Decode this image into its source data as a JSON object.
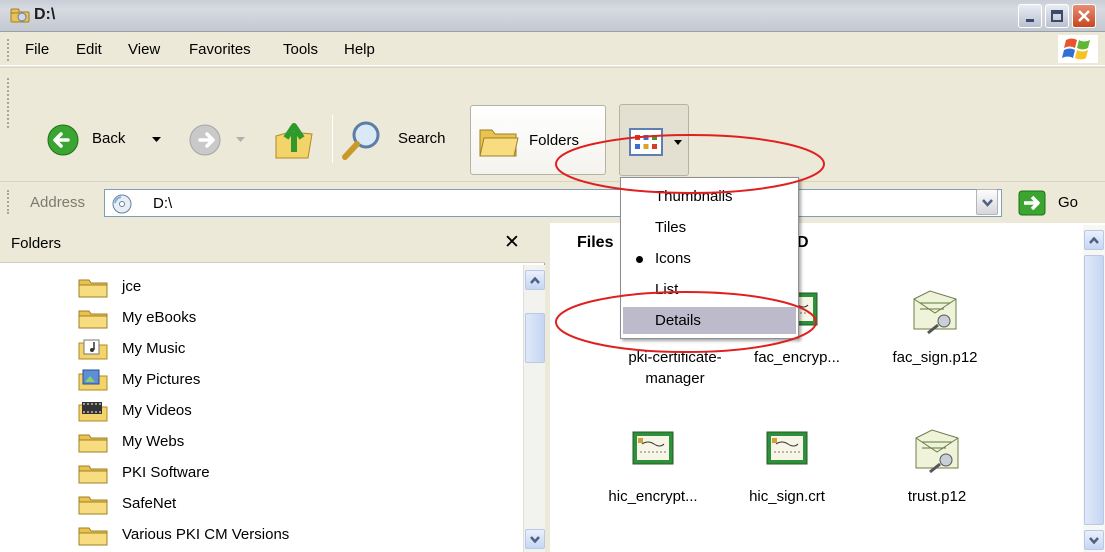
{
  "window": {
    "title": "D:\\"
  },
  "menu": [
    "File",
    "Edit",
    "View",
    "Favorites",
    "Tools",
    "Help"
  ],
  "toolbar": {
    "back_label": "Back",
    "search_label": "Search",
    "folders_label": "Folders"
  },
  "address": {
    "label": "Address",
    "value": "D:\\",
    "go_label": "Go"
  },
  "folders_pane": {
    "title": "Folders",
    "close_glyph": "✕",
    "items": [
      {
        "label": "jce",
        "expandable": false
      },
      {
        "label": "My eBooks",
        "expandable": false
      },
      {
        "label": "My Music",
        "expandable": false
      },
      {
        "label": "My Pictures",
        "expandable": false
      },
      {
        "label": "My Videos",
        "expandable": false
      },
      {
        "label": "My Webs",
        "expandable": true
      },
      {
        "label": "PKI Software",
        "expandable": true
      },
      {
        "label": "SafeNet",
        "expandable": true
      },
      {
        "label": "Various PKI CM Versions",
        "expandable": false
      }
    ]
  },
  "files_pane": {
    "heading_left": "Files",
    "heading_right": "CD",
    "files": [
      {
        "name": "pki-certificate-manager",
        "name_lines": [
          "pki-certificate-",
          "manager"
        ],
        "icon": "certificate-icon"
      },
      {
        "name": "fac_encryp...",
        "name_lines": [
          "fac_encryp..."
        ],
        "icon": "certificate-icon"
      },
      {
        "name": "fac_sign.p12",
        "name_lines": [
          "fac_sign.p12"
        ],
        "icon": "pfx-key-icon"
      },
      {
        "name": "hic_encrypt...",
        "name_lines": [
          "hic_encrypt..."
        ],
        "icon": "certificate-icon"
      },
      {
        "name": "hic_sign.crt",
        "name_lines": [
          "hic_sign.crt"
        ],
        "icon": "certificate-icon"
      },
      {
        "name": "trust.p12",
        "name_lines": [
          "trust.p12"
        ],
        "icon": "pfx-key-icon"
      }
    ]
  },
  "views_menu": {
    "items": [
      {
        "label": "Thumbnails",
        "selected": false,
        "highlighted": false
      },
      {
        "label": "Tiles",
        "selected": false,
        "highlighted": false
      },
      {
        "label": "Icons",
        "selected": true,
        "highlighted": false
      },
      {
        "label": "List",
        "selected": false,
        "highlighted": false
      },
      {
        "label": "Details",
        "selected": false,
        "highlighted": true
      }
    ]
  },
  "colors": {
    "annotation": "#e02020",
    "menu_highlight": "#bdbacb",
    "window_face": "#ece9d8",
    "folder_yellow": "#f3d46a"
  }
}
